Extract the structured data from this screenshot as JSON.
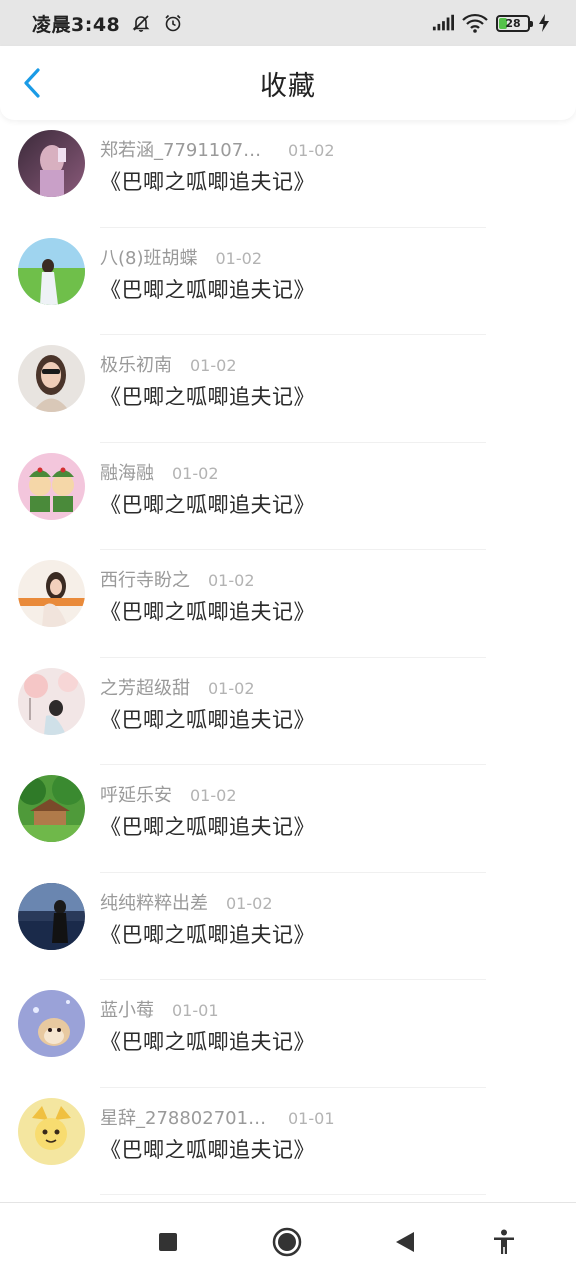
{
  "status_bar": {
    "time": "凌晨3:48",
    "icons": [
      "mute-bell-icon",
      "alarm-clock-icon",
      "signal-icon",
      "wifi-icon",
      "charging-icon"
    ],
    "battery_level": "28",
    "battery_fraction": 0.28
  },
  "header": {
    "title": "收藏",
    "back_icon": "chevron-left-icon",
    "accent_color": "#1a9be6"
  },
  "items": [
    {
      "name": "郑若涵_77911079…",
      "date": "01-02",
      "title": "《巴唧之呱唧追夫记》"
    },
    {
      "name": "八(8)班胡蝶",
      "date": "01-02",
      "title": "《巴唧之呱唧追夫记》"
    },
    {
      "name": "极乐初南",
      "date": "01-02",
      "title": "《巴唧之呱唧追夫记》"
    },
    {
      "name": "融海融",
      "date": "01-02",
      "title": "《巴唧之呱唧追夫记》"
    },
    {
      "name": "西行寺盼之",
      "date": "01-02",
      "title": "《巴唧之呱唧追夫记》"
    },
    {
      "name": "之芳超级甜",
      "date": "01-02",
      "title": "《巴唧之呱唧追夫记》"
    },
    {
      "name": "呼延乐安",
      "date": "01-02",
      "title": "《巴唧之呱唧追夫记》"
    },
    {
      "name": "纯纯粹粹出差",
      "date": "01-02",
      "title": "《巴唧之呱唧追夫记》"
    },
    {
      "name": "蓝小莓",
      "date": "01-01",
      "title": "《巴唧之呱唧追夫记》"
    },
    {
      "name": "星辞_2788027019…",
      "date": "01-01",
      "title": "《巴唧之呱唧追夫记》"
    }
  ],
  "nav_bar": {
    "icons": [
      "recents-square-icon",
      "home-circle-icon",
      "back-triangle-icon",
      "accessibility-icon"
    ]
  }
}
